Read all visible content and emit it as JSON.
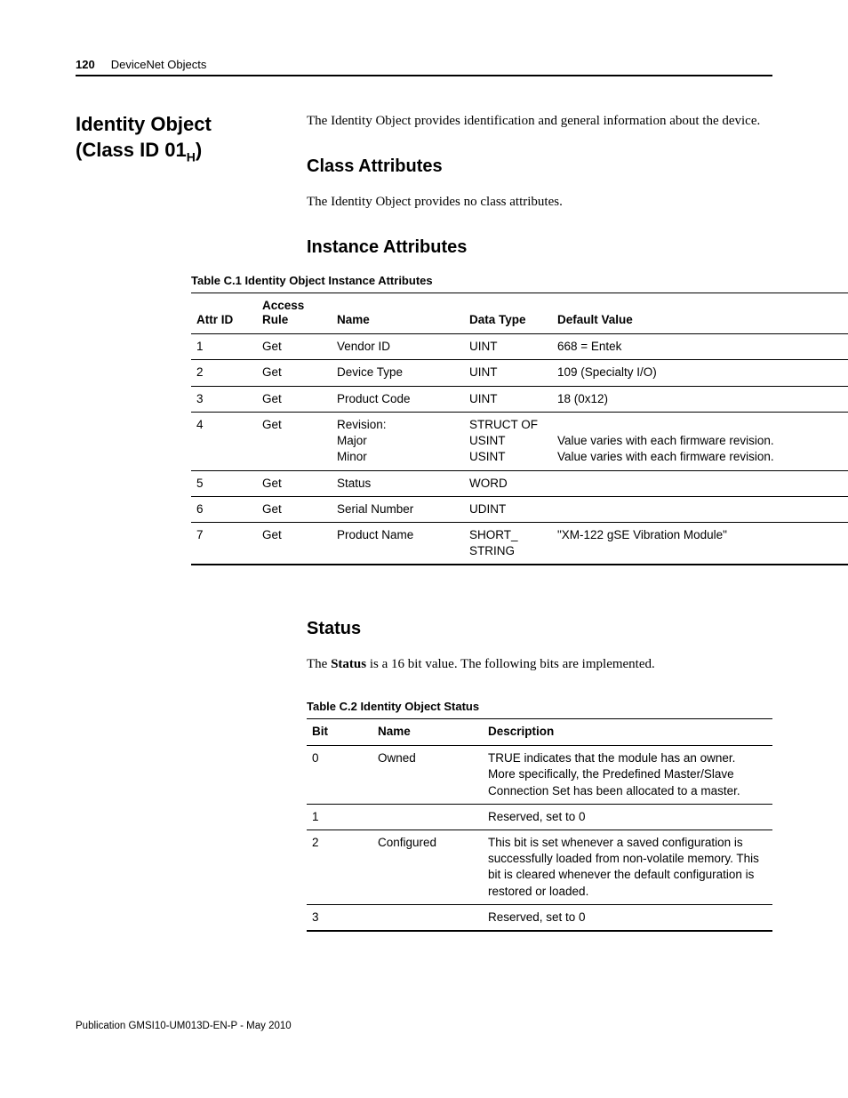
{
  "header": {
    "page_number": "120",
    "chapter": "DeviceNet Objects"
  },
  "section": {
    "title_line1": "Identity Object",
    "title_line2_pre": "(Class ID 01",
    "title_line2_sub": "H",
    "title_line2_post": ")",
    "intro": "The Identity Object provides identification and general information about the device."
  },
  "class_attrs": {
    "heading": "Class Attributes",
    "text": "The Identity Object provides no class attributes."
  },
  "instance_attrs": {
    "heading": "Instance Attributes",
    "table_caption": "Table C.1 Identity Object Instance Attributes",
    "headers": [
      "Attr ID",
      "Access\nRule",
      "Name",
      "Data Type",
      "Default Value"
    ],
    "rows": [
      [
        "1",
        "Get",
        "Vendor ID",
        "UINT",
        "668 = Entek"
      ],
      [
        "2",
        "Get",
        "Device Type",
        "UINT",
        "109 (Specialty I/O)"
      ],
      [
        "3",
        "Get",
        "Product Code",
        "UINT",
        "18 (0x12)"
      ],
      [
        "4",
        "Get",
        "Revision:\nMajor\nMinor",
        "STRUCT OF\nUSINT\nUSINT",
        "\nValue varies with each firmware revision.\nValue varies with each firmware revision."
      ],
      [
        "5",
        "Get",
        "Status",
        "WORD",
        ""
      ],
      [
        "6",
        "Get",
        "Serial Number",
        "UDINT",
        ""
      ],
      [
        "7",
        "Get",
        "Product Name",
        "SHORT_\nSTRING",
        "\"XM-122 gSE Vibration Module\""
      ]
    ]
  },
  "status": {
    "heading": "Status",
    "text_pre": "The ",
    "text_bold": "Status",
    "text_post": " is a 16 bit value. The following bits are implemented.",
    "table_caption": "Table C.2 Identity Object Status",
    "headers": [
      "Bit",
      "Name",
      "Description"
    ],
    "rows": [
      [
        "0",
        "Owned",
        "TRUE indicates that the module has an owner. More specifically, the Predefined Master/Slave Connection Set has been allocated to a master."
      ],
      [
        "1",
        "",
        "Reserved, set to 0"
      ],
      [
        "2",
        "Configured",
        "This bit is set whenever a saved configuration is successfully loaded from non-volatile memory. This bit is cleared whenever the default configuration is restored or loaded."
      ],
      [
        "3",
        "",
        "Reserved, set to 0"
      ]
    ]
  },
  "footer": {
    "text": "Publication GMSI10-UM013D-EN-P - May 2010"
  }
}
